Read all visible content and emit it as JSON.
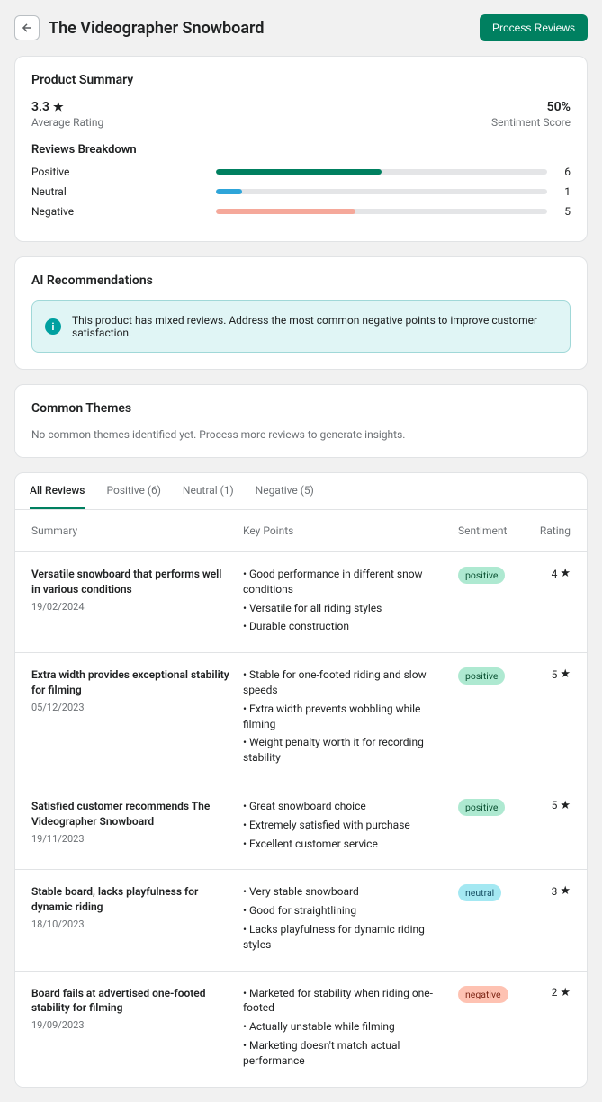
{
  "header": {
    "title": "The Videographer Snowboard",
    "process_btn": "Process Reviews"
  },
  "summary": {
    "title": "Product Summary",
    "avg_rating": "3.3",
    "avg_label": "Average Rating",
    "sentiment_score": "50%",
    "sentiment_label": "Sentiment Score"
  },
  "breakdown": {
    "title": "Reviews Breakdown",
    "rows": [
      {
        "label": "Positive",
        "count": "6",
        "pct": 50,
        "cls": "bar-positive"
      },
      {
        "label": "Neutral",
        "count": "1",
        "pct": 8,
        "cls": "bar-neutral"
      },
      {
        "label": "Negative",
        "count": "5",
        "pct": 42,
        "cls": "bar-negative"
      }
    ]
  },
  "recs": {
    "title": "AI Recommendations",
    "text": "This product has mixed reviews. Address the most common negative points to improve customer satisfaction."
  },
  "themes": {
    "title": "Common Themes",
    "text": "No common themes identified yet. Process more reviews to generate insights."
  },
  "tabs": [
    {
      "label": "All Reviews",
      "active": true
    },
    {
      "label": "Positive (6)",
      "active": false
    },
    {
      "label": "Neutral (1)",
      "active": false
    },
    {
      "label": "Negative (5)",
      "active": false
    }
  ],
  "table": {
    "headers": {
      "summary": "Summary",
      "key": "Key Points",
      "sentiment": "Sentiment",
      "rating": "Rating"
    },
    "rows": [
      {
        "title": "Versatile snowboard that performs well in various conditions",
        "date": "19/02/2024",
        "points": [
          "Good performance in different snow conditions",
          "Versatile for all riding styles",
          "Durable construction"
        ],
        "sentiment": "positive",
        "rating": "4"
      },
      {
        "title": "Extra width provides exceptional stability for filming",
        "date": "05/12/2023",
        "points": [
          "Stable for one-footed riding and slow speeds",
          "Extra width prevents wobbling while filming",
          "Weight penalty worth it for recording stability"
        ],
        "sentiment": "positive",
        "rating": "5"
      },
      {
        "title": "Satisfied customer recommends The Videographer Snowboard",
        "date": "19/11/2023",
        "points": [
          "Great snowboard choice",
          "Extremely satisfied with purchase",
          "Excellent customer service"
        ],
        "sentiment": "positive",
        "rating": "5"
      },
      {
        "title": "Stable board, lacks playfulness for dynamic riding",
        "date": "18/10/2023",
        "points": [
          "Very stable snowboard",
          "Good for straightlining",
          "Lacks playfulness for dynamic riding styles"
        ],
        "sentiment": "neutral",
        "rating": "3"
      },
      {
        "title": "Board fails at advertised one-footed stability for filming",
        "date": "19/09/2023",
        "points": [
          "Marketed for stability when riding one-footed",
          "Actually unstable while filming",
          "Marketing doesn't match actual performance"
        ],
        "sentiment": "negative",
        "rating": "2"
      }
    ]
  }
}
